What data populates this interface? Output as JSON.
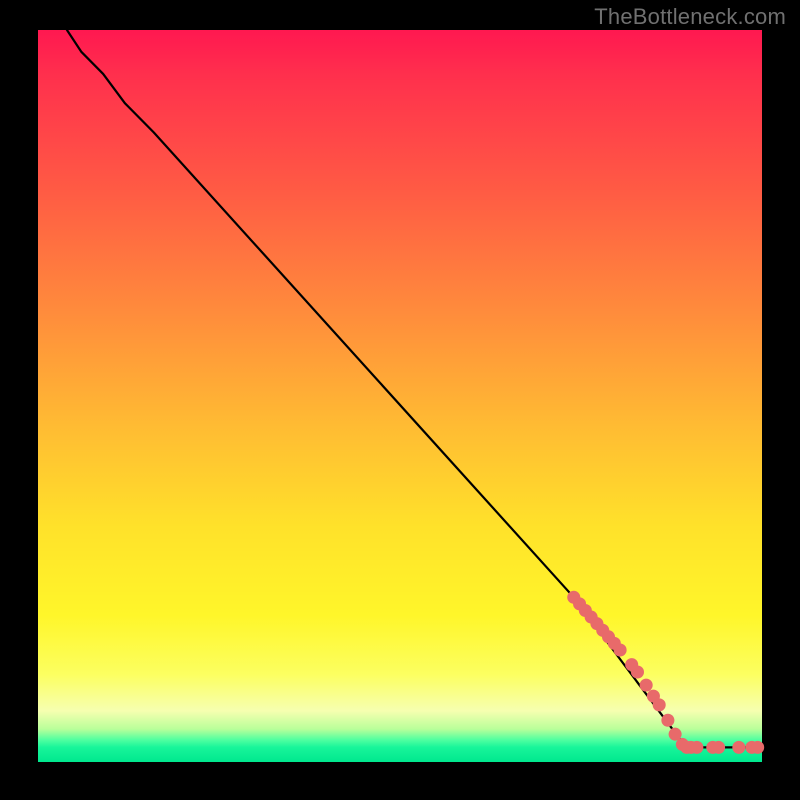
{
  "watermark": "TheBottleneck.com",
  "colors": {
    "marker": "#e86a6a",
    "curve": "#000000",
    "frame": "#000000"
  },
  "chart_data": {
    "type": "line",
    "title": "",
    "xlabel": "",
    "ylabel": "",
    "xlim": [
      0,
      100
    ],
    "ylim": [
      0,
      100
    ],
    "curve": [
      {
        "x": 4,
        "y": 100
      },
      {
        "x": 6,
        "y": 97
      },
      {
        "x": 9,
        "y": 94
      },
      {
        "x": 12,
        "y": 90
      },
      {
        "x": 16,
        "y": 86
      },
      {
        "x": 74,
        "y": 22.5
      },
      {
        "x": 88,
        "y": 4
      },
      {
        "x": 89.5,
        "y": 2
      },
      {
        "x": 90,
        "y": 2
      },
      {
        "x": 100,
        "y": 2
      }
    ],
    "markers": [
      {
        "x": 74.0,
        "y": 22.5
      },
      {
        "x": 74.8,
        "y": 21.6
      },
      {
        "x": 75.6,
        "y": 20.7
      },
      {
        "x": 76.4,
        "y": 19.8
      },
      {
        "x": 77.2,
        "y": 18.9
      },
      {
        "x": 78.0,
        "y": 18.0
      },
      {
        "x": 78.8,
        "y": 17.1
      },
      {
        "x": 79.6,
        "y": 16.2
      },
      {
        "x": 80.4,
        "y": 15.3
      },
      {
        "x": 82.0,
        "y": 13.3
      },
      {
        "x": 82.8,
        "y": 12.3
      },
      {
        "x": 84.0,
        "y": 10.5
      },
      {
        "x": 85.0,
        "y": 9.0
      },
      {
        "x": 85.8,
        "y": 7.8
      },
      {
        "x": 87.0,
        "y": 5.7
      },
      {
        "x": 88.0,
        "y": 3.8
      },
      {
        "x": 89.0,
        "y": 2.4
      },
      {
        "x": 89.6,
        "y": 2.0
      },
      {
        "x": 90.2,
        "y": 2.0
      },
      {
        "x": 91.0,
        "y": 2.0
      },
      {
        "x": 93.2,
        "y": 2.0
      },
      {
        "x": 94.0,
        "y": 2.0
      },
      {
        "x": 96.8,
        "y": 2.0
      },
      {
        "x": 98.6,
        "y": 2.0
      },
      {
        "x": 99.4,
        "y": 2.0
      }
    ],
    "marker_radius_data_units": 0.9
  }
}
